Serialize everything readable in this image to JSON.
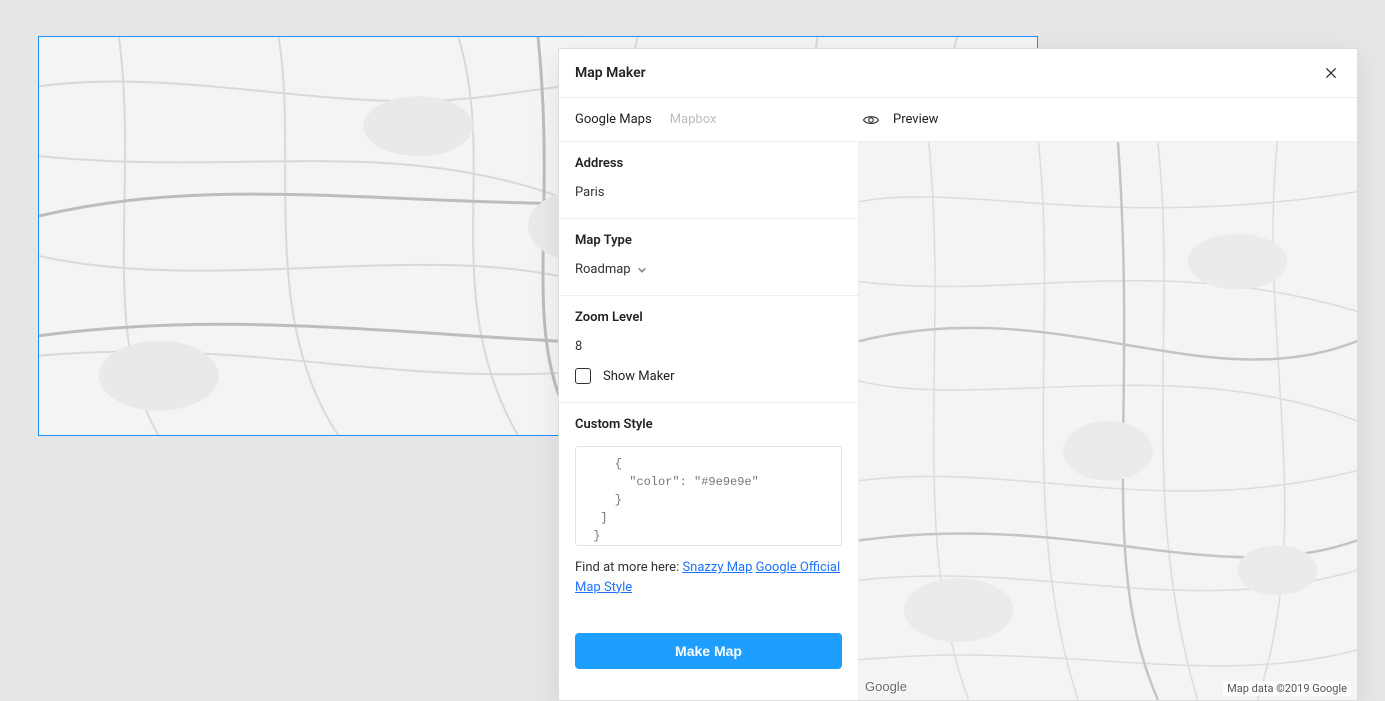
{
  "modal": {
    "title": "Map Maker",
    "tabs": {
      "google": "Google Maps",
      "mapbox": "Mapbox"
    },
    "preview_label": "Preview",
    "address": {
      "label": "Address",
      "value": "Paris"
    },
    "map_type": {
      "label": "Map Type",
      "value": "Roadmap"
    },
    "zoom": {
      "label": "Zoom Level",
      "value": "8"
    },
    "show_marker_label": "Show Maker",
    "custom_style": {
      "label": "Custom Style",
      "code": "    {\n      \"color\": \"#9e9e9e\"\n    }\n  ]\n }\n]"
    },
    "find_more_prefix": "Find at more here: ",
    "links": {
      "snazzy": "Snazzy Map",
      "google_style": "Google Official Map Style"
    },
    "make_button": "Make Map",
    "google_badge": "Google",
    "attribution": "Map data ©2019 Google"
  }
}
